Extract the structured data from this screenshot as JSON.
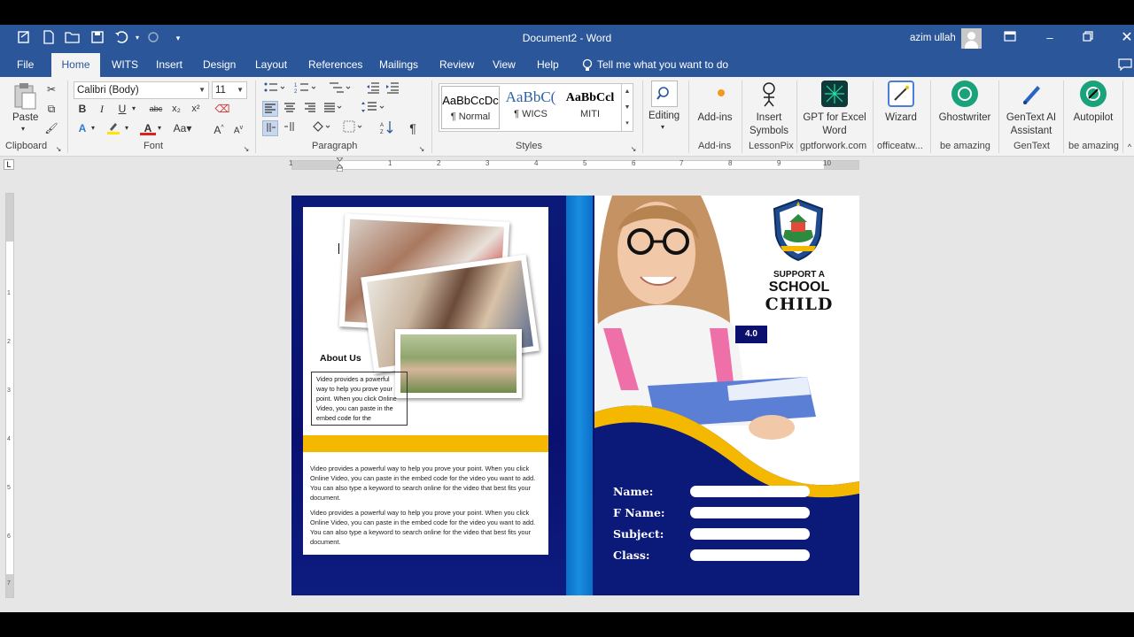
{
  "window": {
    "title": "Document2 - Word",
    "user": "azim ullah"
  },
  "qat": {
    "icons": [
      "autoformat-icon",
      "new-doc-icon",
      "open-icon",
      "save-icon",
      "undo-icon",
      "redo-icon",
      "customize-qat-icon"
    ]
  },
  "tabs": [
    "File",
    "Home",
    "WITS",
    "Insert",
    "Design",
    "Layout",
    "References",
    "Mailings",
    "Review",
    "View",
    "Help"
  ],
  "tell_me": "Tell me what you want to do",
  "ribbon": {
    "clipboard": {
      "paste": "Paste",
      "label": "Clipboard"
    },
    "font": {
      "name": "Calibri (Body)",
      "size": "11",
      "label": "Font"
    },
    "paragraph": {
      "label": "Paragraph"
    },
    "styles": {
      "label": "Styles",
      "items": [
        {
          "preview": "AaBbCcDc",
          "name": "¶ Normal"
        },
        {
          "preview": "AaBbC(",
          "name": "¶ WICS"
        },
        {
          "preview": "AaBbCcl",
          "name": "MITI"
        }
      ]
    },
    "editing": {
      "label": "Editing"
    },
    "addins": [
      {
        "title": "Add-ins",
        "group": "Add-ins"
      },
      {
        "title": "Insert Symbols",
        "group": "LessonPix"
      },
      {
        "title": "GPT for Excel Word",
        "group": "gptforwork.com"
      },
      {
        "title": "Wizard",
        "group": "officeatw..."
      },
      {
        "title": "Ghostwriter",
        "group": "be amazing"
      },
      {
        "title": "GenText AI Assistant",
        "group": "GenText"
      },
      {
        "title": "Autopilot",
        "group": "be amazing"
      }
    ]
  },
  "document": {
    "about_title": "About Us",
    "about_text": "Video provides a powerful way to help you prove your point. When you click Online Video, you can paste in the embed code for the",
    "para1": "Video provides a powerful way to help you prove your point. When you click Online Video, you can paste in the embed code for the video you want to add. You can also type a keyword to search online for the video that best fits your document.",
    "para2": "Video provides a powerful way to help you prove your point. When you click Online Video, you can paste in the embed code for the video you want to add. You can also type a keyword to search online for the video that best fits your document.",
    "support_line1": "SUPPORT A",
    "support_line2": "SCHOOL",
    "support_line3": "CHILD",
    "badge": "4.0",
    "form_labels": [
      "Name:",
      "F Name:",
      "Subject:",
      "Class:"
    ]
  },
  "ruler": {
    "numbers": [
      "1",
      "1",
      "2",
      "3",
      "4",
      "5",
      "6",
      "7",
      "8",
      "9",
      "10"
    ],
    "vertical_numbers": [
      "1",
      "2",
      "3",
      "4",
      "5",
      "6",
      "7"
    ]
  },
  "colors": {
    "word_blue": "#2b579a",
    "navy": "#0b1a78",
    "gold": "#f5b800",
    "accent_blue": "#1a8ee0"
  }
}
